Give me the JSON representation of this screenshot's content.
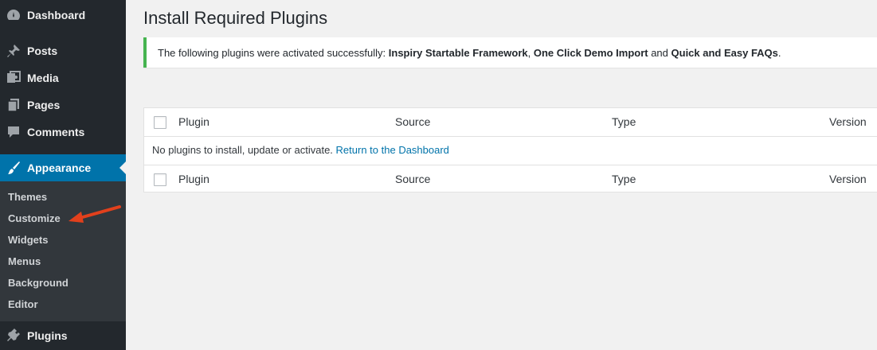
{
  "sidebar": {
    "items": [
      {
        "label": "Dashboard",
        "icon": "dashboard-icon"
      },
      {
        "label": "Posts",
        "icon": "pin-icon"
      },
      {
        "label": "Media",
        "icon": "media-icon"
      },
      {
        "label": "Pages",
        "icon": "pages-icon"
      },
      {
        "label": "Comments",
        "icon": "comment-icon"
      },
      {
        "label": "Appearance",
        "icon": "paintbrush-icon",
        "active": true
      },
      {
        "label": "Plugins",
        "icon": "plugin-icon"
      }
    ],
    "submenu": [
      "Themes",
      "Customize",
      "Widgets",
      "Menus",
      "Background",
      "Editor"
    ],
    "active_color": "#0073aa"
  },
  "main": {
    "title": "Install Required Plugins",
    "notice": {
      "prefix": "The following plugins were activated successfully: ",
      "plugin1": "Inspiry Startable Framework",
      "sep1": ", ",
      "plugin2": "One Click Demo Import",
      "sep2": " and ",
      "plugin3": "Quick and Easy FAQs",
      "suffix": ".",
      "border_color": "#46b450"
    },
    "table": {
      "columns": [
        "Plugin",
        "Source",
        "Type",
        "Version"
      ],
      "empty_message": "No plugins to install, update or activate.",
      "return_link": "Return to the Dashboard"
    }
  }
}
